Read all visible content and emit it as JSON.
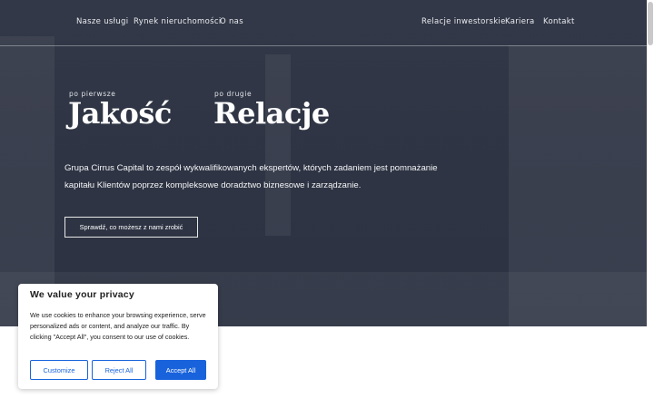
{
  "nav": {
    "left": [
      "Nasze usługi",
      "Rynek nieruchomości",
      "O nas"
    ],
    "right": [
      "Relacje inwestorskie",
      "Kariera",
      "Kontakt"
    ]
  },
  "hero": {
    "first_eyebrow": "po pierwsze",
    "first_title": "Jakość",
    "second_eyebrow": "po drugie",
    "second_title": "Relacje",
    "lead": "Grupa Cirrus Capital to zespół wykwalifikowanych ekspertów, których zadaniem jest pomnażanie kapitału Klientów poprzez kompleksowe doradztwo biznesowe i zarządzanie.",
    "cta": "Sprawdź, co możesz z nami zrobić"
  },
  "cookie": {
    "title": "We value your privacy",
    "text": "We use cookies to enhance your browsing experience, serve personalized ads or content, and analyze our traffic. By clicking \"Accept All\", you consent to our use of cookies.",
    "customize": "Customize",
    "reject": "Reject All",
    "accept": "Accept All"
  },
  "colors": {
    "accent": "#1863dc",
    "hero_overlay": "#282e3e"
  }
}
